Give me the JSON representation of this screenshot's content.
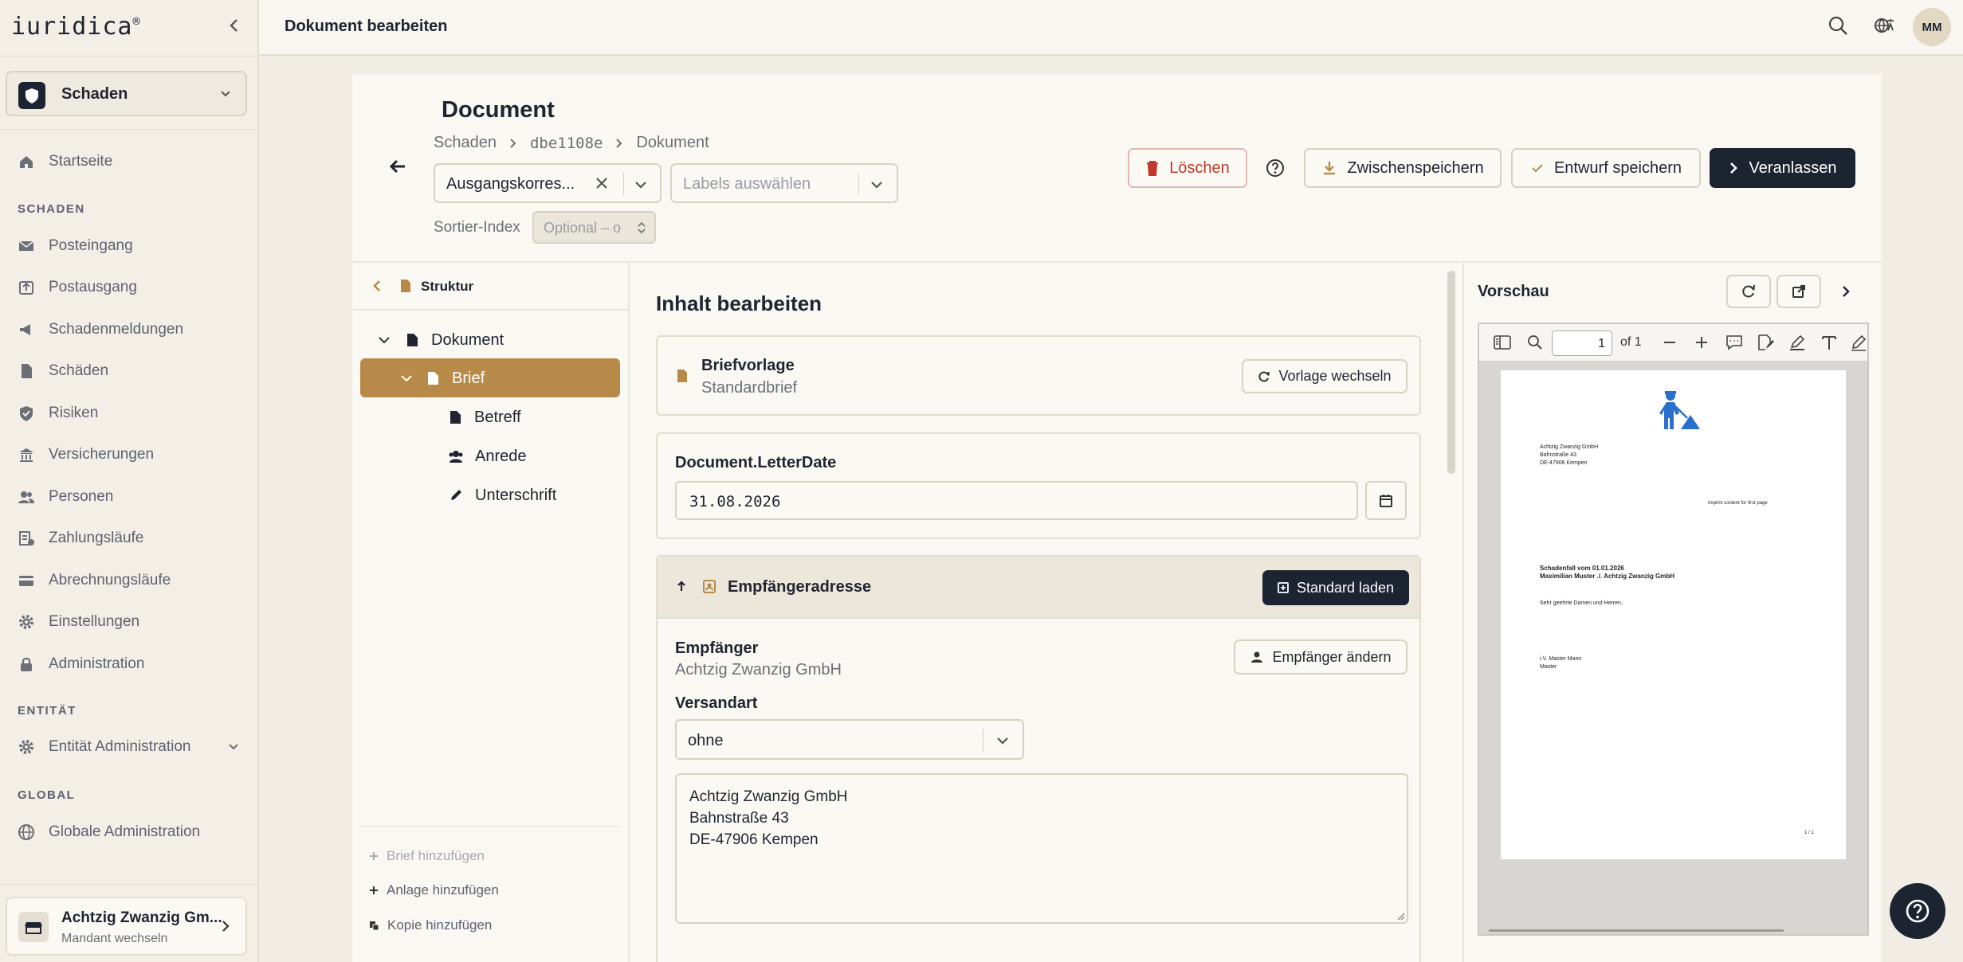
{
  "app": {
    "logo": "iuridica",
    "logo_mark": "®"
  },
  "sidebar": {
    "context": "Schaden",
    "startseite": "Startseite",
    "section_schaden": "SCHADEN",
    "items": [
      "Posteingang",
      "Postausgang",
      "Schadenmeldungen",
      "Schäden",
      "Risiken",
      "Versicherungen",
      "Personen",
      "Zahlungsläufe",
      "Abrechnungsläufe",
      "Einstellungen",
      "Administration"
    ],
    "section_entitaet": "ENTITÄT",
    "entitaet_admin": "Entität Administration",
    "section_global": "GLOBAL",
    "global_admin": "Globale Administration",
    "tenant": {
      "name": "Achtzig Zwanzig Gm...",
      "sub": "Mandant wechseln"
    }
  },
  "topbar": {
    "title": "Dokument bearbeiten",
    "avatar": "MM"
  },
  "document": {
    "title": "Document",
    "breadcrumb": [
      "Schaden",
      "dbe1108e",
      "Dokument"
    ],
    "type_value": "Ausgangskorres...",
    "labels_placeholder": "Labels auswählen",
    "sort_label": "Sortier-Index",
    "sort_placeholder": "Optional – o",
    "actions": {
      "delete": "Löschen",
      "save_temp": "Zwischenspeichern",
      "save_draft": "Entwurf speichern",
      "dispatch": "Veranlassen"
    }
  },
  "tree": {
    "header": "Struktur",
    "root": "Dokument",
    "selected": "Brief",
    "children": [
      "Betreff",
      "Anrede",
      "Unterschrift"
    ],
    "add_letter": "Brief hinzufügen",
    "add_attachment": "Anlage hinzufügen",
    "add_copy": "Kopie hinzufügen"
  },
  "editor": {
    "title": "Inhalt bearbeiten",
    "template_label": "Briefvorlage",
    "template_value": "Standardbrief",
    "template_button": "Vorlage wechseln",
    "date_label": "Document.LetterDate",
    "date_value": "31.08.2026",
    "address_section": "Empfängeradresse",
    "load_default": "Standard laden",
    "recipient_label": "Empfänger",
    "recipient_value": "Achtzig Zwanzig GmbH",
    "change_recipient": "Empfänger ändern",
    "shipping_label": "Versandart",
    "shipping_value": "ohne",
    "address_lines": [
      "Achtzig Zwanzig GmbH",
      "Bahnstraße 43",
      "DE-47906 Kempen"
    ]
  },
  "preview": {
    "title": "Vorschau",
    "page_input": "1",
    "page_of": "of 1",
    "page": {
      "sender": [
        "Achtzig Zwanzig GmbH",
        "Bahnstraße 43",
        "DE-47906 Kempen"
      ],
      "imprint": "Imprint content for first page",
      "subject": [
        "Schadenfall vom 01.01.2026",
        "Maximilian Muster ./. Achtzig Zwanzig GmbH"
      ],
      "salutation": "Sehr geehrte Damen und Herren,",
      "signature": [
        "i.V. Master Mann",
        "Master"
      ],
      "page_number": "1 / 1"
    }
  },
  "colors": {
    "accent": "#b88a4a",
    "dark": "#1c2331",
    "danger": "#c0392b"
  }
}
